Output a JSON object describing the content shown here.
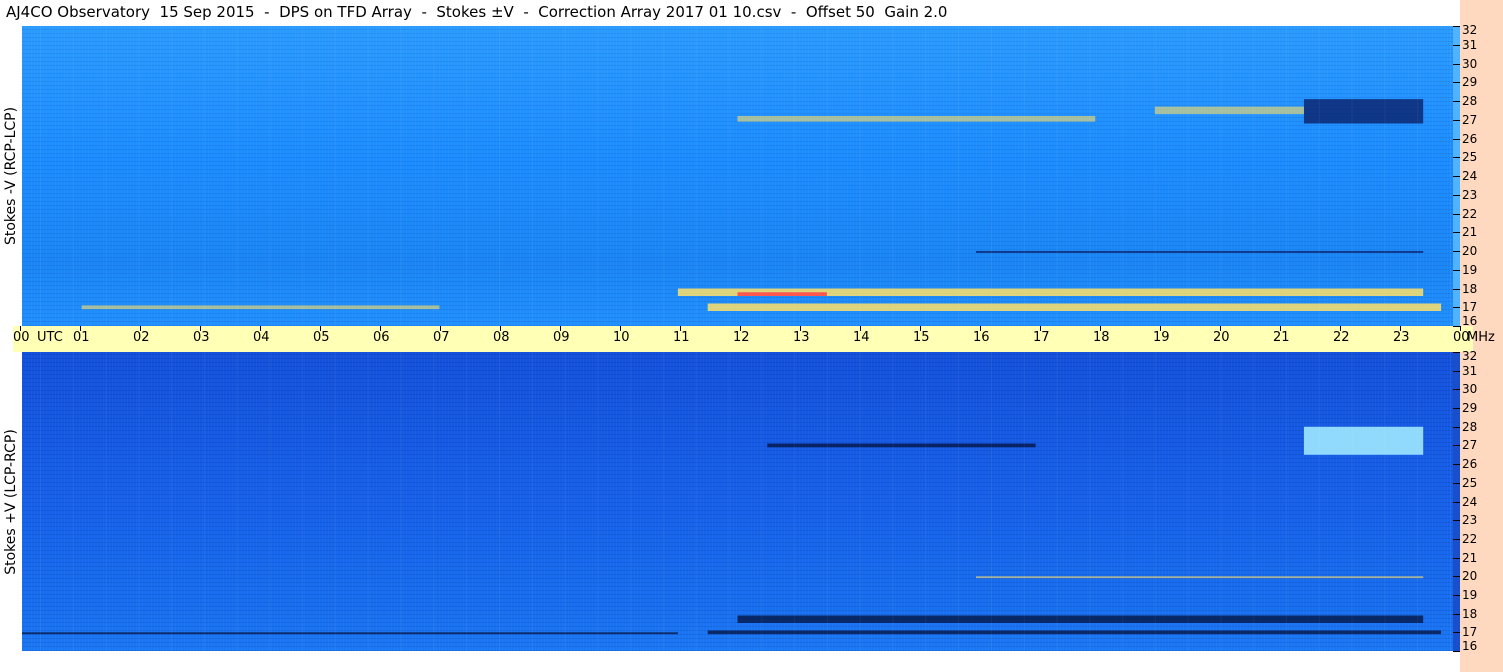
{
  "title": "AJ4CO Observatory  15 Sep 2015  -  DPS on TFD Array  -  Stokes ±V  -  Correction Array 2017 01 10.csv  -  Offset 50  Gain 2.0",
  "chart_data": [
    {
      "type": "heatmap",
      "ylabel": "Stokes -V (RCP-LCP)",
      "y_unit": "MHz",
      "x_unit": "UTC",
      "x": [
        "00",
        "01",
        "02",
        "03",
        "04",
        "05",
        "06",
        "07",
        "08",
        "09",
        "10",
        "11",
        "12",
        "13",
        "14",
        "15",
        "16",
        "17",
        "18",
        "19",
        "20",
        "21",
        "22",
        "23",
        "00"
      ],
      "xlim": [
        0,
        24
      ],
      "y_ticks": [
        16,
        17,
        18,
        19,
        20,
        21,
        22,
        23,
        24,
        25,
        26,
        27,
        28,
        29,
        30,
        31,
        32
      ],
      "ylim": [
        16,
        32
      ],
      "colors": {
        "background": "#1f8fff",
        "strong": "#ffe066",
        "peak": "#ff4a4a",
        "low": "#0a1a60"
      },
      "features": [
        {
          "t_start": 11.0,
          "t_end": 23.5,
          "f_low": 17.6,
          "f_high": 18.0,
          "level": "strong"
        },
        {
          "t_start": 11.5,
          "t_end": 23.8,
          "f_low": 16.8,
          "f_high": 17.2,
          "level": "strong"
        },
        {
          "t_start": 12.0,
          "t_end": 13.5,
          "f_low": 17.6,
          "f_high": 17.8,
          "level": "peak"
        },
        {
          "t_start": 1.0,
          "t_end": 7.0,
          "f_low": 16.9,
          "f_high": 17.1,
          "level": "moderate"
        },
        {
          "t_start": 21.5,
          "t_end": 23.5,
          "f_low": 26.8,
          "f_high": 28.1,
          "level": "low"
        },
        {
          "t_start": 12.0,
          "t_end": 18.0,
          "f_low": 26.9,
          "f_high": 27.2,
          "level": "moderate"
        },
        {
          "t_start": 19.0,
          "t_end": 21.5,
          "f_low": 27.3,
          "f_high": 27.7,
          "level": "moderate"
        },
        {
          "t_start": 16.0,
          "t_end": 23.5,
          "f_low": 19.9,
          "f_high": 20.0,
          "level": "low"
        }
      ]
    },
    {
      "type": "heatmap",
      "ylabel": "Stokes +V (LCP-RCP)",
      "y_unit": "MHz",
      "x_unit": "UTC",
      "x": [
        "00",
        "01",
        "02",
        "03",
        "04",
        "05",
        "06",
        "07",
        "08",
        "09",
        "10",
        "11",
        "12",
        "13",
        "14",
        "15",
        "16",
        "17",
        "18",
        "19",
        "20",
        "21",
        "22",
        "23",
        "00"
      ],
      "xlim": [
        0,
        24
      ],
      "y_ticks": [
        16,
        17,
        18,
        19,
        20,
        21,
        22,
        23,
        24,
        25,
        26,
        27,
        28,
        29,
        30,
        31,
        32
      ],
      "ylim": [
        16,
        32
      ],
      "colors": {
        "background": "#145ee8",
        "strong": "#ffe066",
        "peak": "#9fe8ff",
        "low": "#04103a"
      },
      "features": [
        {
          "t_start": 12.0,
          "t_end": 23.5,
          "f_low": 17.5,
          "f_high": 17.9,
          "level": "low"
        },
        {
          "t_start": 11.5,
          "t_end": 23.8,
          "f_low": 16.9,
          "f_high": 17.1,
          "level": "low"
        },
        {
          "t_start": 21.5,
          "t_end": 23.5,
          "f_low": 26.5,
          "f_high": 28.0,
          "level": "peak"
        },
        {
          "t_start": 12.5,
          "t_end": 17.0,
          "f_low": 26.9,
          "f_high": 27.1,
          "level": "low"
        },
        {
          "t_start": 16.0,
          "t_end": 23.5,
          "f_low": 19.9,
          "f_high": 20.0,
          "level": "moderate"
        },
        {
          "t_start": 0.0,
          "t_end": 11.0,
          "f_low": 16.9,
          "f_high": 17.0,
          "level": "low"
        }
      ]
    }
  ]
}
